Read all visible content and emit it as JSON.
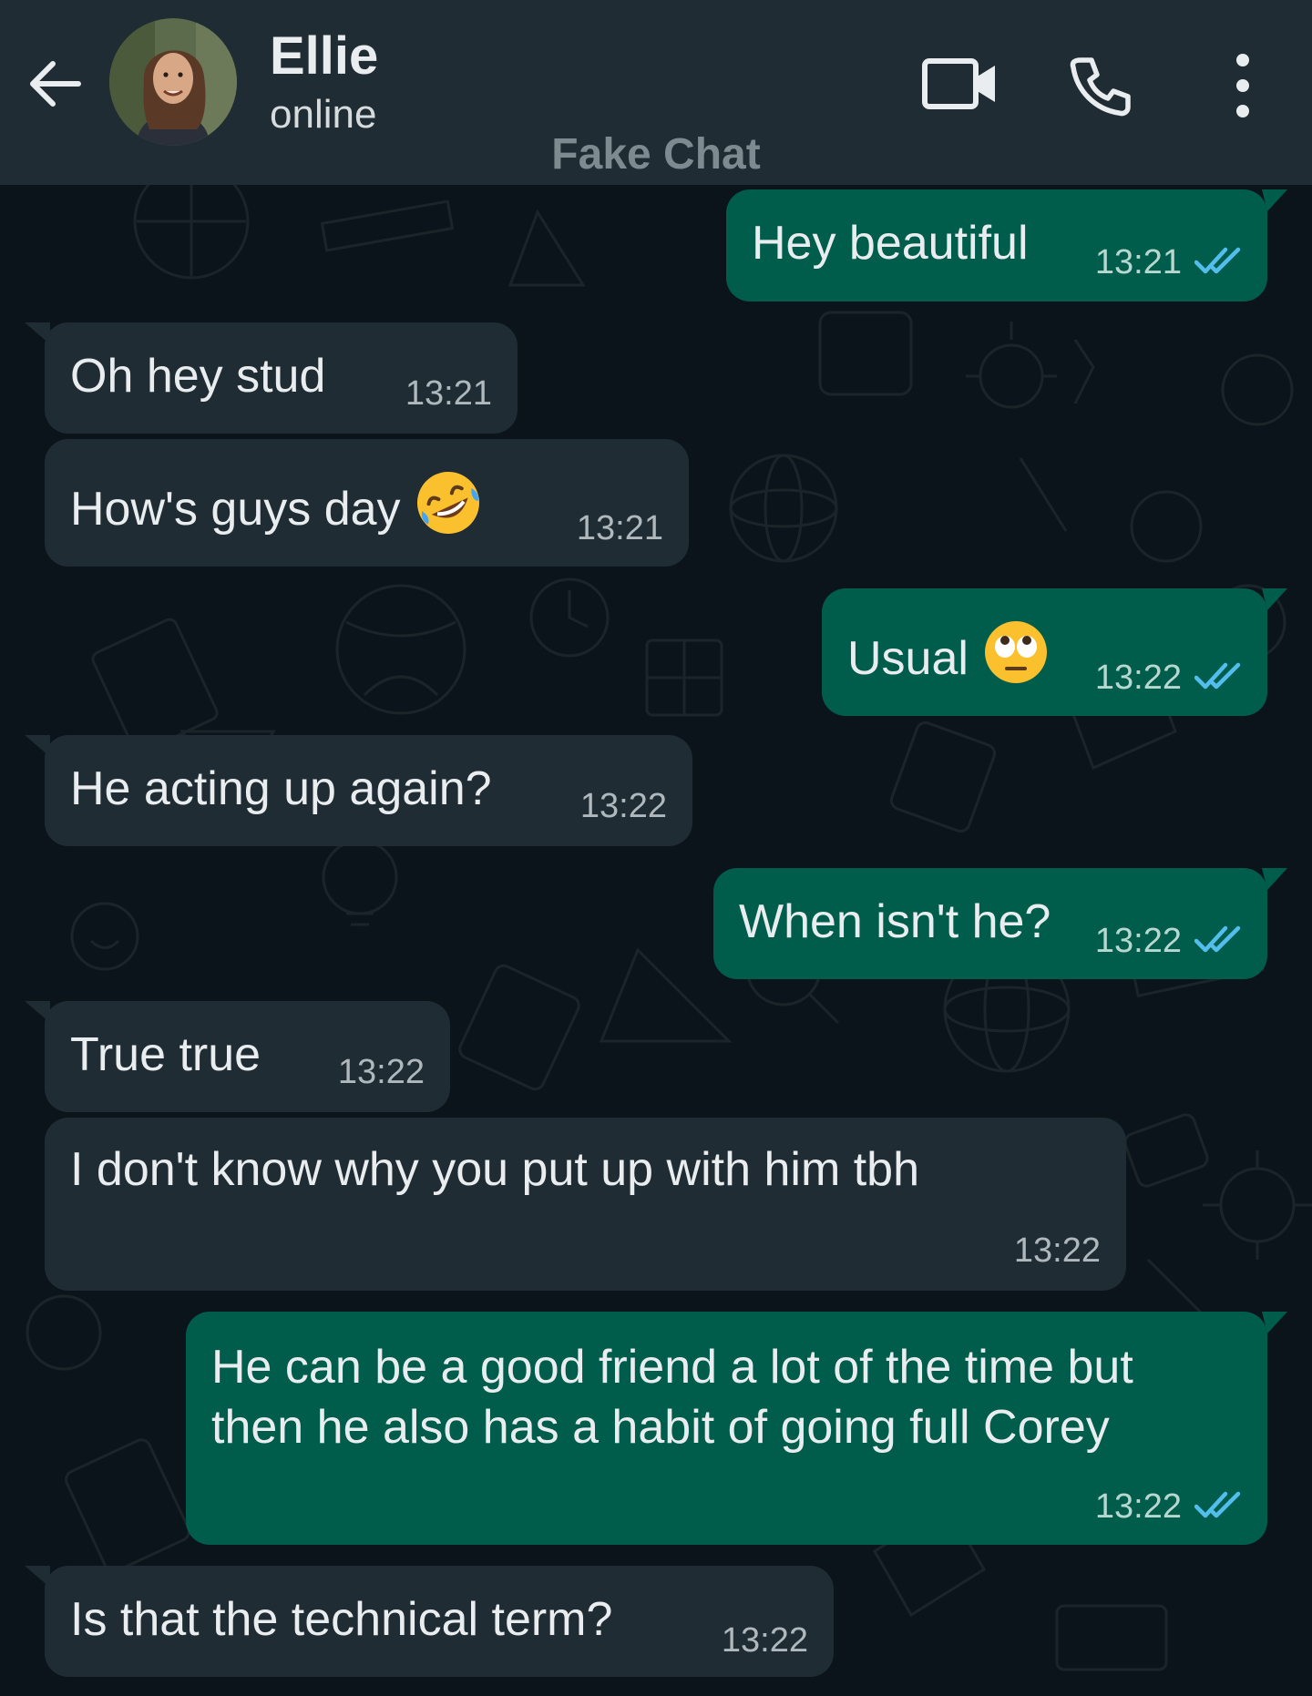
{
  "header": {
    "contact_name": "Ellie",
    "status": "online",
    "watermark": "Fake Chat",
    "icons": [
      "back-arrow-icon",
      "avatar",
      "video-call-icon",
      "phone-icon",
      "more-vert-icon"
    ]
  },
  "messages": [
    {
      "direction": "outgoing",
      "text": "Hey beautiful",
      "time": "13:21",
      "read": true
    },
    {
      "direction": "incoming",
      "text": "Oh hey stud",
      "time": "13:21"
    },
    {
      "direction": "incoming",
      "text": "How's guys day",
      "emoji": "rolling-on-floor-laughing",
      "time": "13:21"
    },
    {
      "direction": "outgoing",
      "text": "Usual",
      "emoji": "eye-roll",
      "time": "13:22",
      "read": true
    },
    {
      "direction": "incoming",
      "text": "He acting up again?",
      "time": "13:22"
    },
    {
      "direction": "outgoing",
      "text": "When isn't he?",
      "time": "13:22",
      "read": true
    },
    {
      "direction": "incoming",
      "text": "True true",
      "time": "13:22"
    },
    {
      "direction": "incoming",
      "text": "I don't know why you put up with him tbh",
      "time": "13:22"
    },
    {
      "direction": "outgoing",
      "text": "He can be a good friend a lot of the time but then he also has a habit of going full Corey",
      "time": "13:22",
      "read": true
    },
    {
      "direction": "incoming",
      "text": "Is that the technical term?",
      "time": "13:22"
    }
  ],
  "colors": {
    "header_bg": "#1f2c33",
    "chat_bg": "#0b141a",
    "incoming_bubble": "#1f2c33",
    "outgoing_bubble": "#005c4b",
    "read_ticks": "#53bdeb"
  }
}
